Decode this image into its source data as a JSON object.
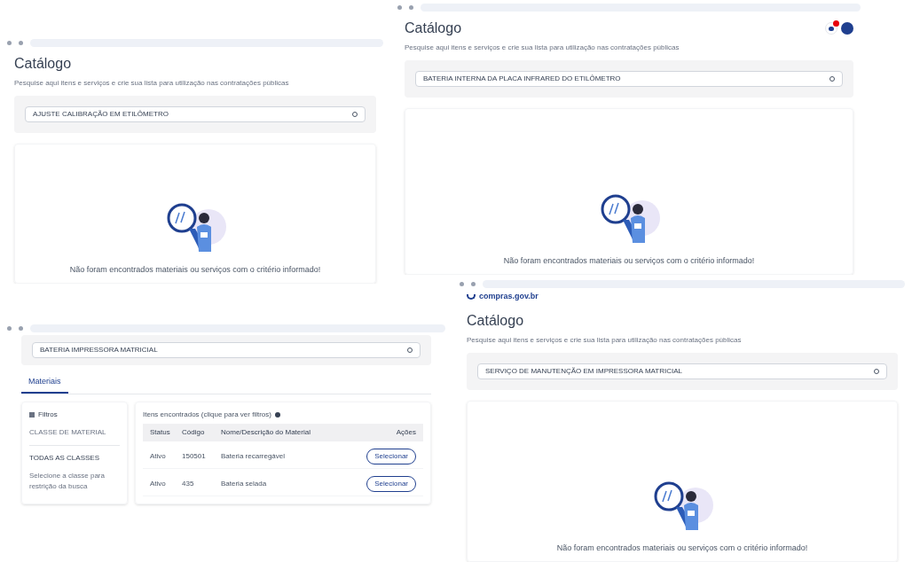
{
  "windows": [
    {
      "kind": "empty",
      "title": "Catálogo",
      "subtitle": "Pesquise aqui itens e serviços e crie sua lista para utilização nas contratações públicas",
      "search": "AJUSTE CALIBRAÇÃO EM ETILÔMETRO",
      "message": "Não foram encontrados materiais ou serviços com o critério informado!"
    },
    {
      "kind": "empty",
      "cart": true,
      "title": "Catálogo",
      "subtitle": "Pesquise aqui itens e serviços e crie sua lista para utilização nas contratações públicas",
      "search": "BATERIA INTERNA DA PLACA INFRARED DO ETILÔMETRO",
      "message": "Não foram encontrados materiais ou serviços com o critério informado!"
    },
    {
      "kind": "results",
      "search": "BATERIA IMPRESSORA MATRICIAL",
      "tabs": [
        {
          "label": "Materiais",
          "selected": true
        }
      ],
      "filters": {
        "title": "Filtros",
        "label": "CLASSE DE MATERIAL",
        "value": "TODAS AS CLASSES",
        "hint": "Selecione a classe para restrição da busca"
      },
      "table": {
        "caption": "Itens encontrados (clique para ver filtros)",
        "columns": [
          "Status",
          "Código",
          "Nome/Descrição do Material",
          "Ações"
        ],
        "rows": [
          {
            "cells": [
              "Ativo",
              "150501",
              "Bateria recarregável"
            ],
            "action": "Selecionar"
          },
          {
            "cells": [
              "Ativo",
              "435",
              "Bateria selada"
            ],
            "action": "Selecionar"
          }
        ]
      }
    },
    {
      "kind": "empty",
      "logo": "compras.gov.br",
      "title": "Catálogo",
      "subtitle": "Pesquise aqui itens e serviços e crie sua lista para utilização nas contratações públicas",
      "search": "SERVIÇO DE MANUTENÇÃO EM IMPRESSORA MATRICIAL",
      "message": "Não foram encontrados materiais ou serviços com o critério informado!"
    }
  ]
}
